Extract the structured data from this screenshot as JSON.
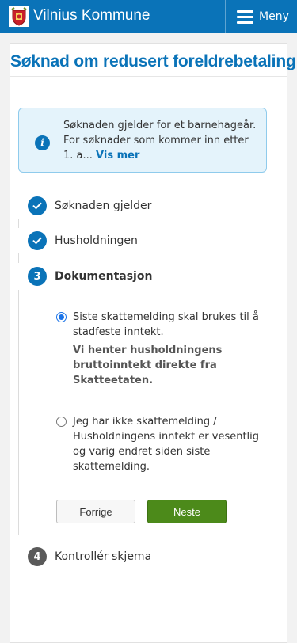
{
  "header": {
    "brand": "Vilnius Kommune",
    "menu_label": "Meny",
    "colors": {
      "bar": "#0a73b8"
    }
  },
  "page": {
    "title": "Søknad om redusert foreldrebetaling"
  },
  "info": {
    "icon": "info-icon",
    "text": "Søknaden gjelder for et barnehageår. For søknader som kommer inn etter 1. a...",
    "more_link": "Vis mer"
  },
  "steps": [
    {
      "number": "1",
      "label": "Søknaden gjelder",
      "status": "done",
      "icon": "check-icon"
    },
    {
      "number": "2",
      "label": "Husholdningen",
      "status": "done",
      "icon": "check-icon"
    },
    {
      "number": "3",
      "label": "Dokumentasjon",
      "status": "active"
    },
    {
      "number": "4",
      "label": "Kontrollér skjema",
      "status": "pending"
    }
  ],
  "options": [
    {
      "text": "Siste skattemelding skal brukes til å stadfeste inntekt.",
      "note": "Vi henter husholdningens bruttoinntekt direkte fra Skatteetaten.",
      "checked": true
    },
    {
      "text": "Jeg har ikke skattemelding / Husholdningens inntekt er vesentlig og varig endret siden siste skattemelding.",
      "checked": false
    }
  ],
  "buttons": {
    "previous": "Forrige",
    "next": "Neste"
  }
}
